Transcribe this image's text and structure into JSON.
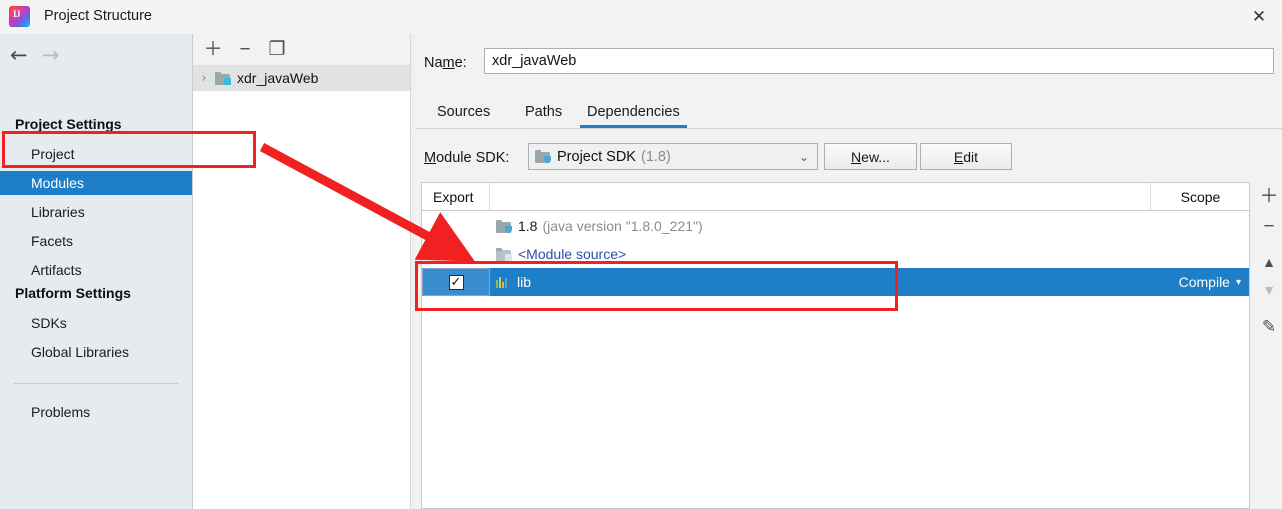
{
  "window": {
    "title": "Project Structure",
    "app_icon": "intellij-idea-icon",
    "close_label": "✕"
  },
  "nav": {
    "back_icon": "←",
    "forward_icon": "→"
  },
  "sidebar": {
    "groups": [
      {
        "label": "Project Settings"
      },
      {
        "label": "Platform Settings"
      }
    ],
    "items": [
      {
        "label": "Project",
        "selected": false
      },
      {
        "label": "Modules",
        "selected": true
      },
      {
        "label": "Libraries",
        "selected": false
      },
      {
        "label": "Facets",
        "selected": false
      },
      {
        "label": "Artifacts",
        "selected": false
      },
      {
        "label": "SDKs",
        "selected": false
      },
      {
        "label": "Global Libraries",
        "selected": false
      },
      {
        "label": "Problems",
        "selected": false
      }
    ]
  },
  "tree_pane": {
    "toolbar": [
      {
        "icon": "plus-icon",
        "glyph": "＋"
      },
      {
        "icon": "minus-icon",
        "glyph": "−"
      },
      {
        "icon": "copy-icon",
        "glyph": "❐"
      }
    ],
    "chevron": "›",
    "module_name": "xdr_javaWeb"
  },
  "content": {
    "name_label": "Name:",
    "name_value": "xdr_javaWeb",
    "tabs": [
      {
        "label": "Sources",
        "active": false
      },
      {
        "label": "Paths",
        "active": false
      },
      {
        "label": "Dependencies",
        "active": true
      }
    ],
    "sdk_label": "Module SDK:",
    "sdk_value": "Project SDK",
    "sdk_version": "(1.8)",
    "sdk_chevron": "⌄",
    "buttons": [
      {
        "label": "New...",
        "mnemonic": "N"
      },
      {
        "label": "Edit",
        "mnemonic": "E"
      }
    ]
  },
  "table": {
    "columns": [
      "Export",
      "",
      "Scope"
    ],
    "rows": [
      {
        "export_checked": false,
        "show_checkbox": false,
        "icon": "sdk-folder-icon",
        "name": "1.8",
        "detail": "(java version \"1.8.0_221\")",
        "scope": "",
        "selected": false,
        "link": false
      },
      {
        "export_checked": false,
        "show_checkbox": false,
        "icon": "module-source-folder-icon",
        "name": "<Module source>",
        "detail": "",
        "scope": "",
        "selected": false,
        "link": true
      },
      {
        "export_checked": true,
        "show_checkbox": true,
        "icon": "library-icon",
        "name": "lib",
        "detail": "",
        "scope": "Compile",
        "scope_chevron": "▾",
        "selected": true,
        "link": false
      }
    ]
  },
  "vtoolbar": [
    {
      "name": "add-dependency-button",
      "glyph": "＋",
      "enabled": true
    },
    {
      "name": "remove-dependency-button",
      "glyph": "−",
      "enabled": true
    },
    {
      "name": "move-up-button",
      "glyph": "▲",
      "enabled": true
    },
    {
      "name": "move-down-button",
      "glyph": "▼",
      "enabled": false
    },
    {
      "name": "edit-dependency-button",
      "glyph": "✎",
      "enabled": true
    }
  ],
  "annotations": {
    "color": "#f22121",
    "rect_modules": "highlight-modules",
    "rect_lib_row": "highlight-lib-row",
    "arrow": "arrow-modules-to-lib"
  },
  "colors": {
    "accent_blue": "#1e7ec8",
    "sidebar_bg": "#e6ebef",
    "annotation_red": "#f22121"
  }
}
